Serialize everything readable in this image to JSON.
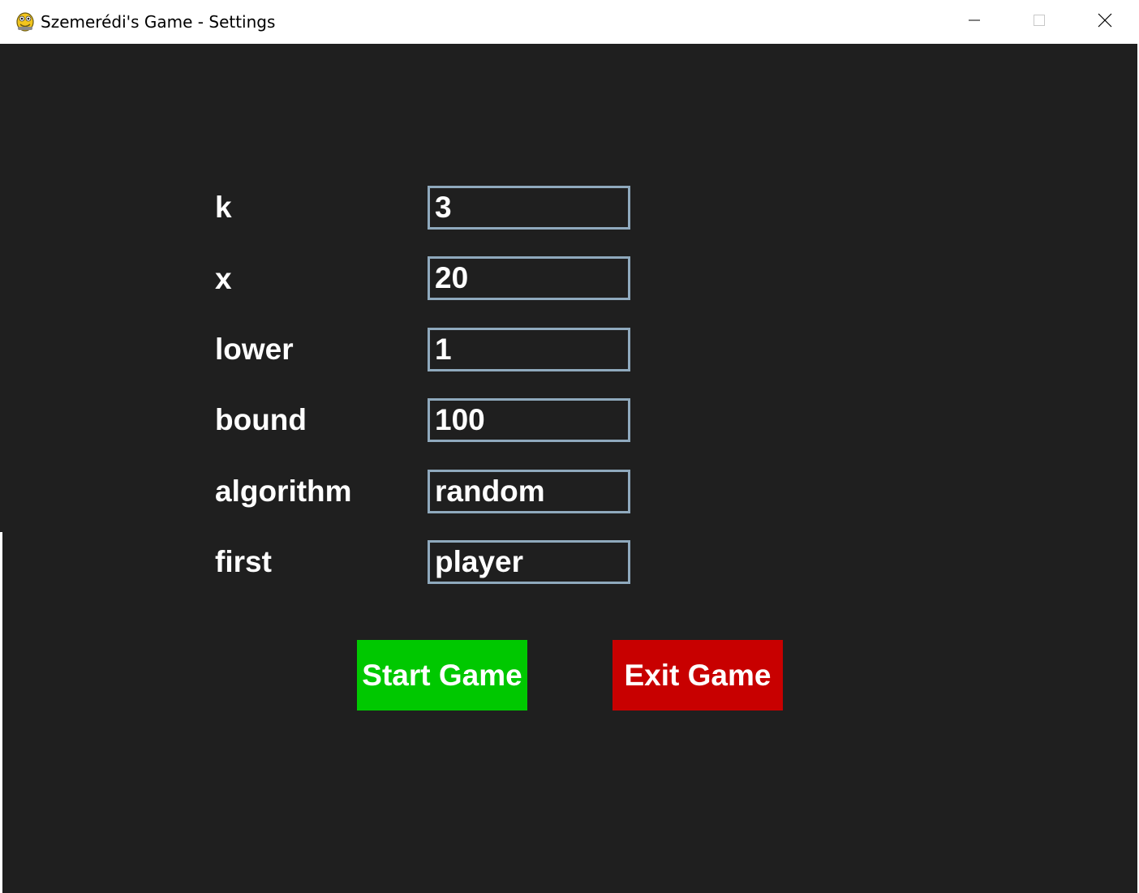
{
  "window": {
    "title": "Szemerédi's Game - Settings",
    "icon": "pygame-snake-icon",
    "controls": [
      "minimize-icon",
      "maximize-icon",
      "close-icon"
    ]
  },
  "settings": {
    "rows": [
      {
        "label": "k",
        "value": "3"
      },
      {
        "label": "x",
        "value": "20"
      },
      {
        "label": "lower",
        "value": "1"
      },
      {
        "label": "bound",
        "value": "100"
      },
      {
        "label": "algorithm",
        "value": "random"
      },
      {
        "label": "first",
        "value": "player"
      }
    ]
  },
  "buttons": {
    "start_label": "Start Game",
    "exit_label": "Exit Game"
  },
  "colors": {
    "background": "#1f1f1f",
    "input_border": "#8fa9bd",
    "start_button": "#00c800",
    "exit_button": "#c80000",
    "text": "#ffffff"
  }
}
